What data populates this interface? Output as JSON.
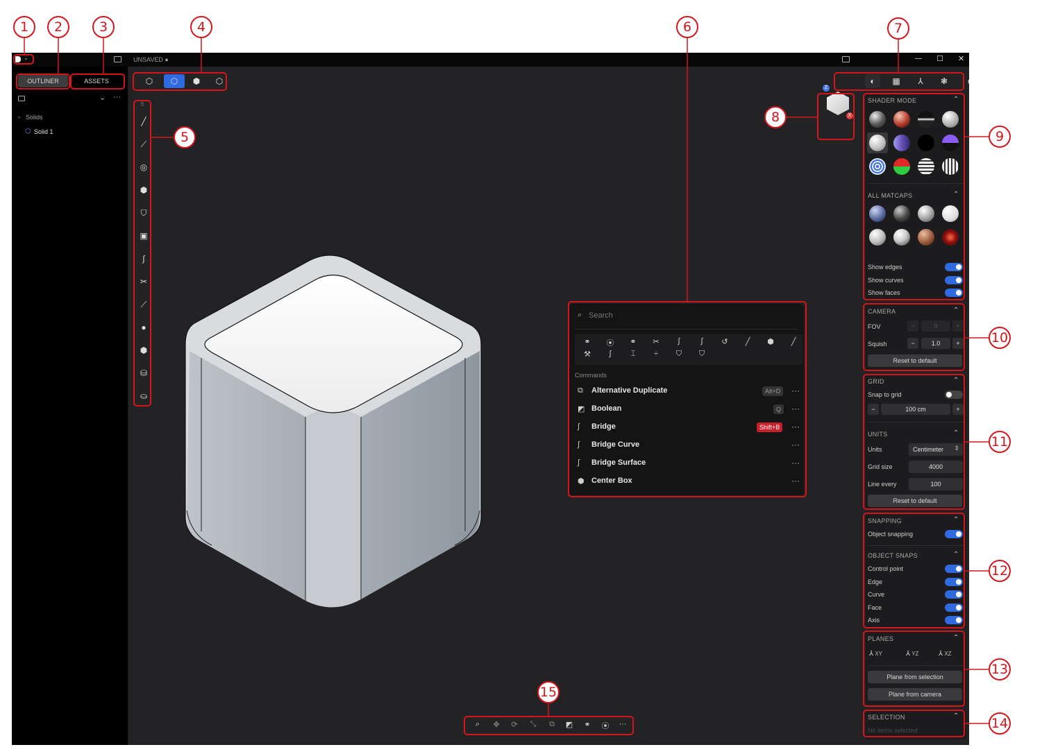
{
  "titlebar": {
    "status": "UNSAVED ●",
    "min": "—",
    "max": "☐",
    "close": "✕"
  },
  "sidebar": {
    "tabs": [
      "OUTLINER",
      "ASSETS"
    ],
    "tree_group": "Solids",
    "tree_item": "Solid 1"
  },
  "command_palette": {
    "search_placeholder": "Search",
    "section_label": "Commands",
    "commands": [
      {
        "label": "Alternative Duplicate",
        "shortcut": "Alt+D"
      },
      {
        "label": "Boolean",
        "shortcut": "Q"
      },
      {
        "label": "Bridge",
        "shortcut": "Shift+B"
      },
      {
        "label": "Bridge Curve",
        "shortcut": ""
      },
      {
        "label": "Bridge Surface",
        "shortcut": ""
      },
      {
        "label": "Center Box",
        "shortcut": ""
      }
    ],
    "more": "···"
  },
  "nav_cube": {
    "z_label": "Z",
    "x_label": "X"
  },
  "shader": {
    "title": "SHADER MODE",
    "all_matcaps_title": "ALL MATCAPS",
    "show_edges": "Show edges",
    "show_curves": "Show curves",
    "show_faces": "Show faces"
  },
  "camera": {
    "title": "CAMERA",
    "fov_label": "FOV",
    "fov_value": "0",
    "squish_label": "Squish",
    "squish_value": "1.0",
    "reset": "Reset to default",
    "minus": "−",
    "plus": "+"
  },
  "grid": {
    "title": "GRID",
    "snap_label": "Snap to grid",
    "size_value": "100 cm",
    "units_title": "UNITS",
    "units_label": "Units",
    "units_value": "Centimeter",
    "grid_size_label": "Grid size",
    "grid_size_value": "4000",
    "line_every_label": "Line every",
    "line_every_value": "100",
    "reset": "Reset to default"
  },
  "snapping": {
    "title": "SNAPPING",
    "object_snapping": "Object snapping",
    "object_snaps_title": "OBJECT SNAPS",
    "snaps": [
      "Control point",
      "Edge",
      "Curve",
      "Face",
      "Axis"
    ]
  },
  "planes": {
    "title": "PLANES",
    "xy": "XY",
    "yz": "YZ",
    "xz": "XZ",
    "from_selection": "Plane from selection",
    "from_camera": "Plane from camera"
  },
  "selection": {
    "title": "SELECTION",
    "empty": "No items selected"
  },
  "callouts": [
    "1",
    "2",
    "3",
    "4",
    "5",
    "6",
    "7",
    "8",
    "9",
    "10",
    "11",
    "12",
    "13",
    "14",
    "15"
  ],
  "colors": {
    "accent": "#2f6ae0",
    "annotation": "#d4151b",
    "shortcut_highlight": "#c8202a"
  }
}
